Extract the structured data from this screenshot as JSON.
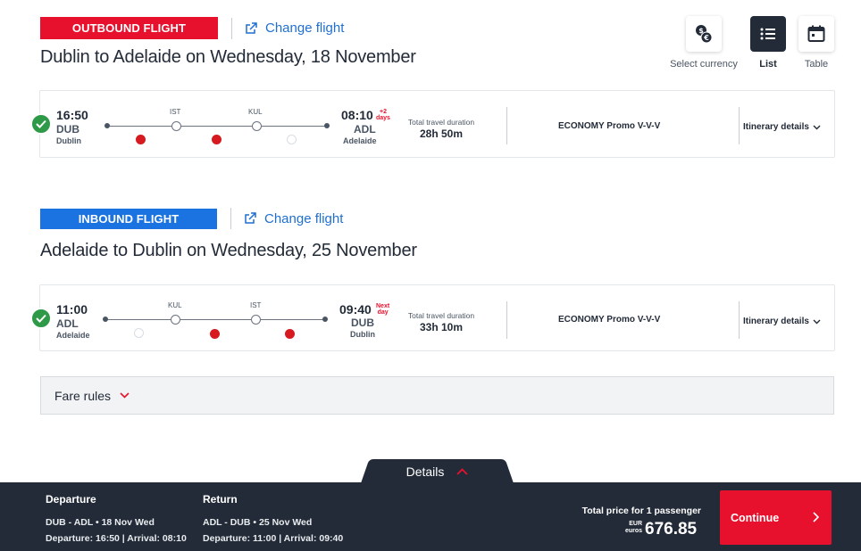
{
  "outbound": {
    "badge": "OUTBOUND FLIGHT",
    "change_label": "Change flight",
    "title": "Dublin to Adelaide on Wednesday, 18 November",
    "dep_time": "16:50",
    "dep_code": "DUB",
    "dep_city": "Dublin",
    "arr_time": "08:10",
    "arr_plus": "+2\ndays",
    "arr_code": "ADL",
    "arr_city": "Adelaide",
    "stops": [
      "IST",
      "KUL"
    ],
    "airlines": [
      "turkish-airlines-icon",
      "turkish-airlines-icon",
      "malaysia-airlines-icon"
    ],
    "duration_label": "Total travel duration",
    "duration": "28h 50m",
    "fare": "ECONOMY Promo V-V-V",
    "itinerary_label": "Itinerary details"
  },
  "inbound": {
    "badge": "INBOUND FLIGHT",
    "change_label": "Change flight",
    "title": "Adelaide to Dublin on Wednesday, 25 November",
    "dep_time": "11:00",
    "dep_code": "ADL",
    "dep_city": "Adelaide",
    "arr_time": "09:40",
    "arr_plus": "Next\nday",
    "arr_code": "DUB",
    "arr_city": "Dublin",
    "stops": [
      "KUL",
      "IST"
    ],
    "airlines": [
      "malaysia-airlines-icon",
      "turkish-airlines-icon",
      "turkish-airlines-icon"
    ],
    "duration_label": "Total travel duration",
    "duration": "33h 10m",
    "fare": "ECONOMY Promo V-V-V",
    "itinerary_label": "Itinerary details"
  },
  "tools": {
    "currency_label": "Select currency",
    "list_label": "List",
    "table_label": "Table"
  },
  "fare_rules": {
    "label": "Fare rules"
  },
  "summary": {
    "details_label": "Details",
    "departure_heading": "Departure",
    "departure_route": "DUB  -  ADL  •  18 Nov Wed",
    "departure_times": "Departure: 16:50 | Arrival: 08:10",
    "return_heading": "Return",
    "return_route": "ADL  -  DUB  •  25 Nov Wed",
    "return_times": "Departure: 11:00 | Arrival: 09:40",
    "total_label": "Total price for 1 passenger",
    "currency_code": "EUR",
    "currency_name": "euros",
    "price": "676.85",
    "continue_label": "Continue"
  },
  "colors": {
    "outbound": "#e8112d",
    "inbound": "#1a73e0",
    "link": "#1f6fd1",
    "dark": "#232b38",
    "success": "#2e9a47"
  }
}
